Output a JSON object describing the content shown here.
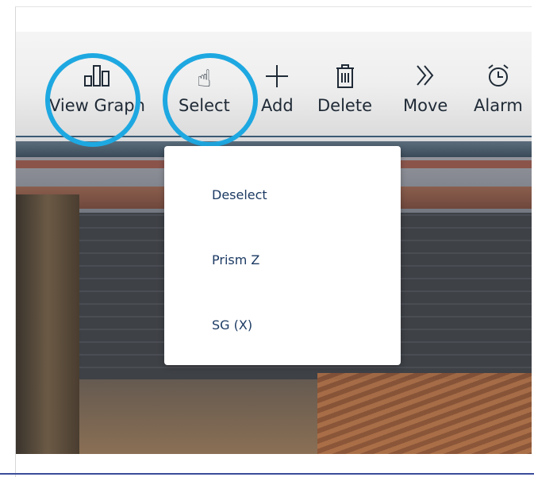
{
  "toolbar": {
    "view_graph": {
      "label": "View Graph",
      "icon": "bar-chart-icon"
    },
    "select": {
      "label": "Select",
      "icon": "tap-hand-icon"
    },
    "add": {
      "label": "Add",
      "icon": "plus-icon"
    },
    "delete": {
      "label": "Delete",
      "icon": "trash-icon"
    },
    "move": {
      "label": "Move",
      "icon": "double-chevron-right-icon"
    },
    "alarm": {
      "label": "Alarm",
      "icon": "alarm-clock-icon"
    }
  },
  "select_menu": {
    "items": [
      "Deselect",
      "Prism Z",
      "SG (X)"
    ]
  },
  "colors": {
    "highlight_ring": "#1ea8e1",
    "menu_text": "#1c3a63",
    "toolbar_text": "#1f2a36"
  }
}
